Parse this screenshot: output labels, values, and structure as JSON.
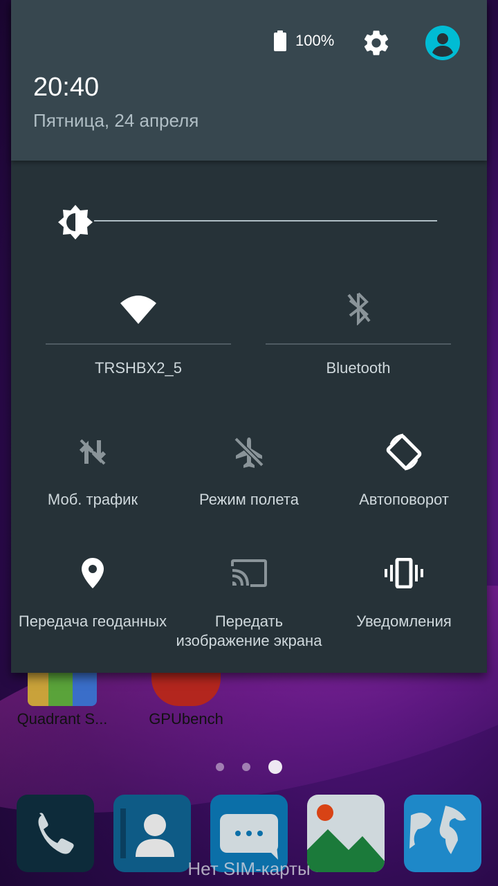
{
  "header": {
    "battery_pct": "100%",
    "time": "20:40",
    "date": "Пятница, 24 апреля"
  },
  "brightness": {
    "level": 0.0
  },
  "tiles": {
    "wifi": "TRSHBX2_5",
    "bluetooth": "Bluetooth",
    "mobile_data": "Моб. трафик",
    "airplane": "Режим полета",
    "autorotate": "Автоповорот",
    "location": "Передача геоданных",
    "cast_line1": "Передать",
    "cast_line2": "изображение экрана",
    "notifications": "Уведомления"
  },
  "home": {
    "apps": [
      "Quadrant S...",
      "GPUbench"
    ],
    "no_sim": "Нет SIM-карты"
  },
  "colors": {
    "shade_bg": "#263238",
    "header_bg": "#37474f",
    "accent": "#00bcd4"
  }
}
